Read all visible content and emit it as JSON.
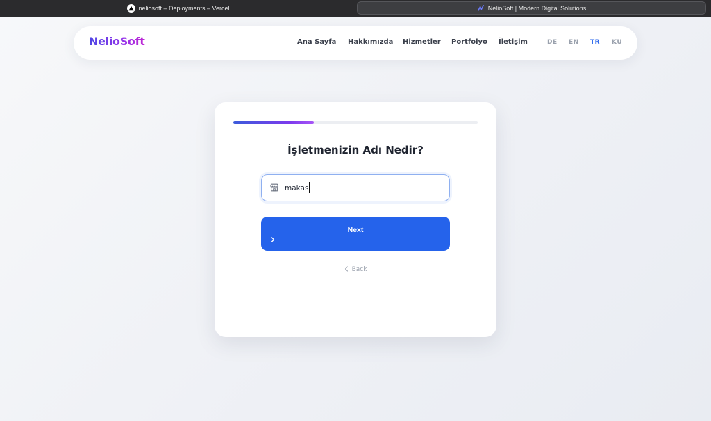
{
  "browser": {
    "tabs": [
      {
        "title": "neliosoft – Deployments – Vercel",
        "icon": "vercel-icon"
      },
      {
        "title": "NelioSoft | Modern Digital Solutions",
        "icon": "neliosoft-favicon"
      }
    ]
  },
  "navbar": {
    "logo": "NelioSoft",
    "links": [
      "Ana Sayfa",
      "Hakkımızda",
      "Hizmetler",
      "Portfolyo",
      "İletişim"
    ],
    "languages": [
      "DE",
      "EN",
      "TR",
      "KU"
    ],
    "active_language": "TR"
  },
  "form": {
    "progress": 0.33,
    "question": "İşletmenizin Adı Nedir?",
    "input_value": "makas",
    "input_icon": "store-icon",
    "next_label": "Next",
    "back_label": "Back"
  },
  "colors": {
    "accent": "#2563eb",
    "logo_gradient_start": "#4f46e5",
    "logo_gradient_end": "#c026d3",
    "progress_gradient_end": "#a855f7"
  }
}
